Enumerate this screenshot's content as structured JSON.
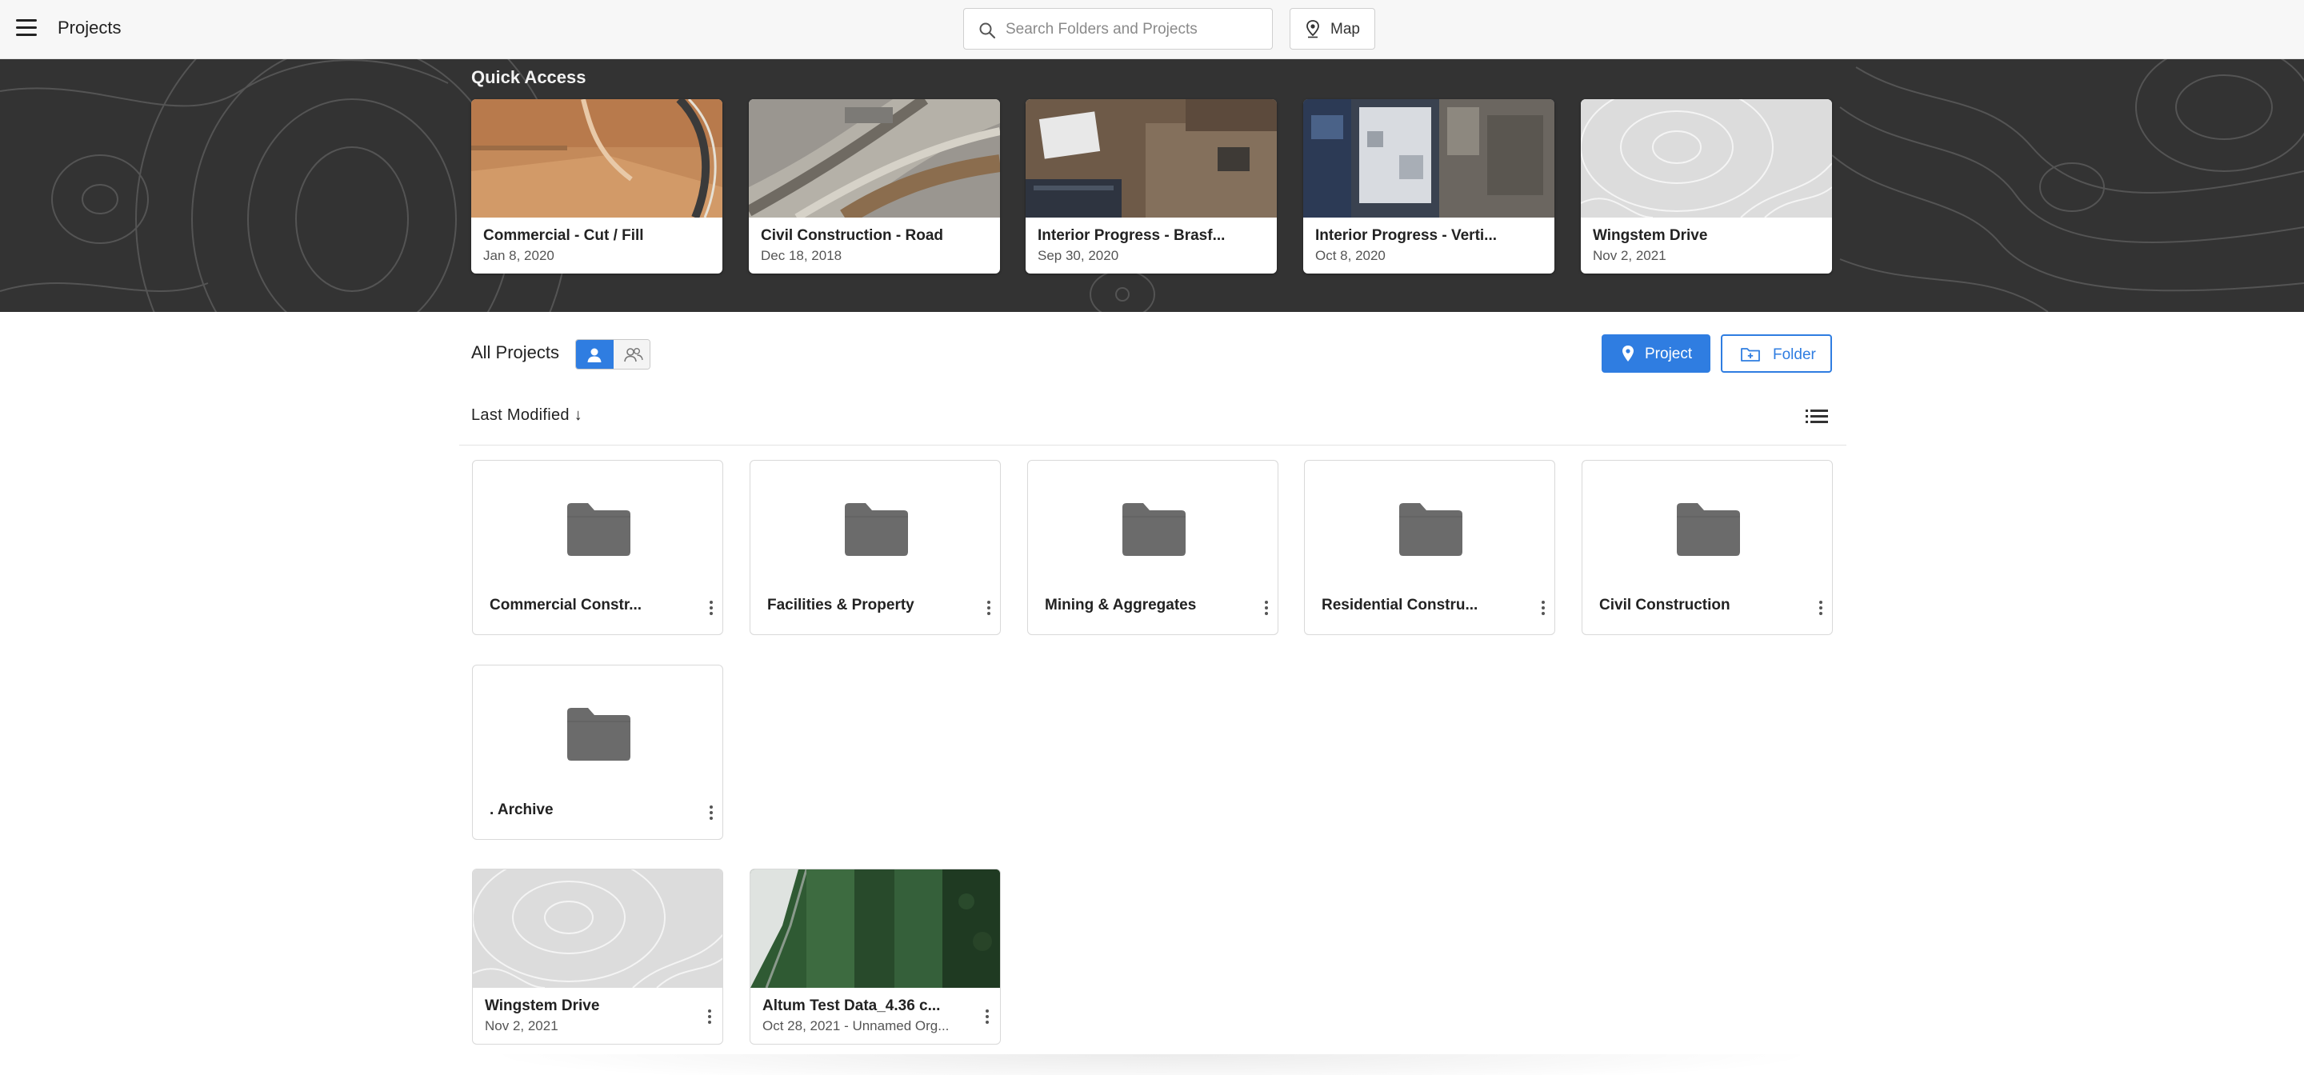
{
  "header": {
    "title": "Projects",
    "search_placeholder": "Search Folders and Projects",
    "map_label": "Map"
  },
  "quick_access": {
    "title": "Quick Access",
    "cards": [
      {
        "name": "Commercial - Cut / Fill",
        "date": "Jan 8, 2020"
      },
      {
        "name": "Civil Construction - Road",
        "date": "Dec 18, 2018"
      },
      {
        "name": "Interior Progress - Brasf...",
        "date": "Sep 30, 2020"
      },
      {
        "name": "Interior Progress - Verti...",
        "date": "Oct 8, 2020"
      },
      {
        "name": "Wingstem Drive",
        "date": "Nov 2, 2021"
      }
    ]
  },
  "all_projects": {
    "title": "All Projects",
    "new_project_label": "Project",
    "new_folder_label": "Folder",
    "sort_label": "Last Modified ↓"
  },
  "folders": [
    {
      "name": "Commercial Constr..."
    },
    {
      "name": "Facilities & Property"
    },
    {
      "name": "Mining & Aggregates"
    },
    {
      "name": "Residential Constru..."
    },
    {
      "name": "Civil Construction"
    },
    {
      "name": ". Archive"
    }
  ],
  "projects": [
    {
      "name": "Wingstem Drive",
      "date": "Nov 2, 2021"
    },
    {
      "name": "Altum Test Data_4.36 c...",
      "date": "Oct 28, 2021 - Unnamed Org..."
    }
  ],
  "colors": {
    "accent": "#2f7de1",
    "banner": "#333333",
    "folder_icon": "#6b6b6b"
  }
}
